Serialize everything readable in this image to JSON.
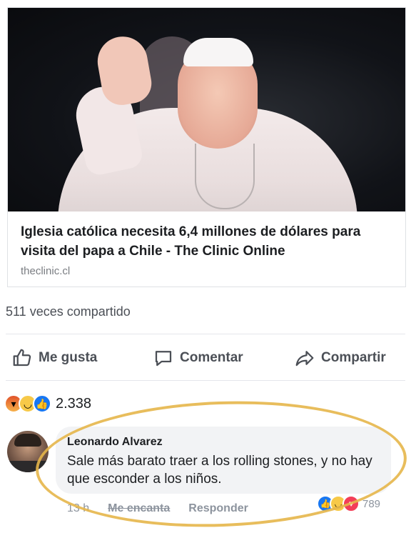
{
  "post": {
    "headline": "Iglesia católica necesita 6,4 millones de dólares para visita del papa a Chile - The Clinic Online",
    "domain": "theclinic.cl",
    "shares": "511 veces compartido"
  },
  "actions": {
    "like": "Me gusta",
    "comment": "Comentar",
    "share": "Compartir"
  },
  "reactions": {
    "count": "2.338",
    "icons": [
      "angry-icon",
      "haha-icon",
      "like-icon"
    ]
  },
  "comment": {
    "author": "Leonardo Alvarez",
    "text": "Sale más barato traer a los rolling stones, y no hay que esconder a los niños.",
    "time": "13 h",
    "love": "Me encanta",
    "reply": "Responder",
    "reaction_count": "789",
    "reaction_icons": [
      "like-icon",
      "haha-icon",
      "love-icon"
    ]
  },
  "colors": {
    "accent": "#1877f2",
    "highlight": "#e6b64a",
    "text": "#1c1e21",
    "muted": "#8d949e"
  }
}
